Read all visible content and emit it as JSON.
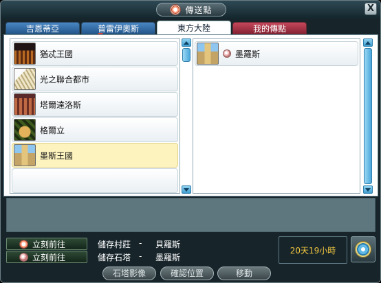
{
  "window": {
    "title": "傳送點",
    "close_label": "X"
  },
  "tabs": [
    {
      "label": "吉恩蒂亞",
      "active": false
    },
    {
      "label": "普雷伊奧斯",
      "active": false
    },
    {
      "label": "東方大陸",
      "active": true
    },
    {
      "label": "我的傳點",
      "active": false
    }
  ],
  "region_list": [
    {
      "label": "猶忒王國",
      "thumb": "fortress",
      "selected": false
    },
    {
      "label": "光之聯合都市",
      "thumb": "light",
      "selected": false
    },
    {
      "label": "塔爾達洛斯",
      "thumb": "tower",
      "selected": false
    },
    {
      "label": "格爾立",
      "thumb": "kerlit",
      "selected": false
    },
    {
      "label": "墨斯王國",
      "thumb": "mosel",
      "selected": true
    }
  ],
  "destination_list": [
    {
      "label": "墨羅斯",
      "thumb": "mosel",
      "icon": "stone-icon"
    }
  ],
  "actions": {
    "go_village_label": "立刻前往",
    "go_stone_label": "立刻前往",
    "saved_village_label": "儲存村莊",
    "saved_village_value": "貝羅斯",
    "saved_stone_label": "儲存石塔",
    "saved_stone_value": "墨羅斯",
    "separator": "-"
  },
  "timer": "20天19小時",
  "footer": {
    "stone_image_label": "石塔影像",
    "confirm_location_label": "確認位置",
    "move_label": "移動"
  },
  "icons": {
    "title": "gear-icon",
    "village": "gear-icon",
    "stone": "stone-icon",
    "compass": "compass-icon"
  },
  "colors": {
    "selected_row": "#fdf3bf",
    "tab_blue": "#23578c",
    "tab_red": "#862334",
    "timer_text": "#f3c73f"
  }
}
